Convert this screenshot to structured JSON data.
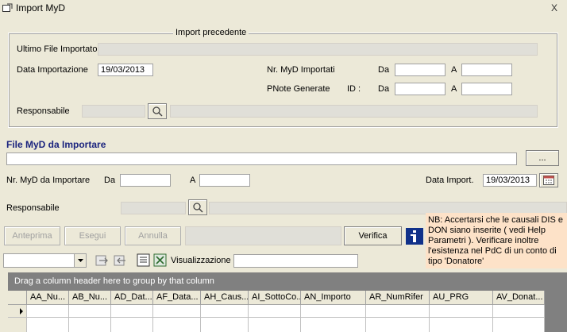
{
  "window": {
    "title": "Import MyD",
    "close_glyph": "X"
  },
  "previous": {
    "legend": "Import precedente",
    "ultimo_file_label": "Ultimo File Importato",
    "data_import_label": "Data Importazione",
    "data_import_value": "19/03/2013",
    "nr_importati_label": "Nr. MyD Importati",
    "pnote_label": "PNote Generate",
    "id_label": "ID :",
    "da_label": "Da",
    "a_label": "A",
    "responsabile_label": "Responsabile"
  },
  "file": {
    "section_title": "File MyD da Importare",
    "browse_label": "...",
    "nr_da_importare_label": "Nr. MyD da Importare",
    "da_label": "Da",
    "a_label": "A",
    "data_import_label": "Data Import.",
    "data_import_value": "19/03/2013",
    "responsabile_label": "Responsabile"
  },
  "actions": {
    "anteprima": "Anteprima",
    "esegui": "Esegui",
    "annulla": "Annulla",
    "verifica": "Verifica"
  },
  "note": "NB: Accertarsi che le causali DIS e DON siano inserite    ( vedi Help Parametri ). Verificare inoltre l'esistenza nel PdC di un conto di tipo 'Donatore'",
  "toolbar": {
    "visualizzazione_label": "Visualizzazione"
  },
  "grid": {
    "group_hint": "Drag a column header here to group by that column",
    "columns": [
      "AA_Nu...",
      "AB_Nu...",
      "AD_Dat...",
      "AF_Data...",
      "AH_Caus...",
      "AI_SottoCo...",
      "AN_Importo",
      "AR_NumRifer",
      "AU_PRG",
      "AV_Donat..."
    ]
  },
  "colors": {
    "note_bg": "#fde2c8",
    "section_title": "#1a237e",
    "window_bg": "#ece9d8"
  }
}
